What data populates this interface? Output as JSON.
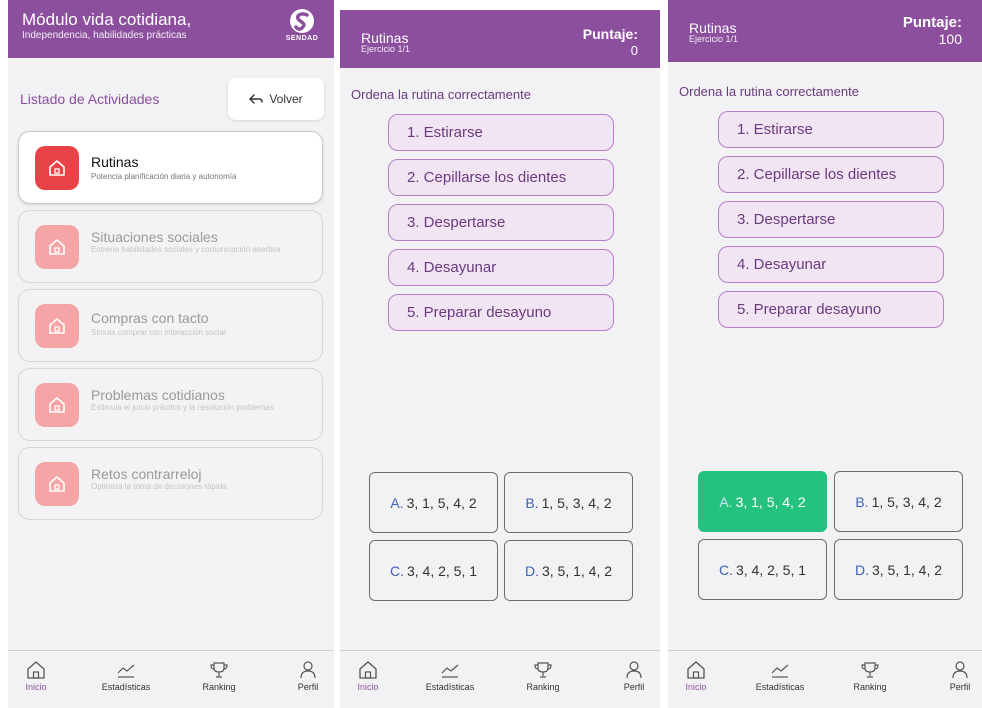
{
  "colors": {
    "header": "#8c4f9e",
    "accent_active_icon": "#e94349",
    "inactive_icon": "#f5a5a5",
    "correct_option": "#25c27f",
    "step_fill": "#f1e5f4"
  },
  "menu_screen": {
    "header": {
      "title": "Módulo vida cotidiana,",
      "subtitle": "Independencia, habilidades prácticas",
      "logo_text": "SENDAD"
    },
    "list_title": "Listado de Actividades",
    "back_label": "Volver",
    "activities": [
      {
        "name": "Rutinas",
        "description": "Potencia planificación diaria y autonomía",
        "icon": "home-icon",
        "active": true
      },
      {
        "name": "Situaciones sociales",
        "description": "Entrena habilidades sociales y comunicación asertiva",
        "icon": "home-icon",
        "active": false
      },
      {
        "name": "Compras con tacto",
        "description": "Simula comprar con interacción social",
        "icon": "home-icon",
        "active": false
      },
      {
        "name": "Problemas cotidianos",
        "description": "Estimula el juicio práctico y la resolución problemas",
        "icon": "home-icon",
        "active": false
      },
      {
        "name": "Retos contrarreloj",
        "description": "Optimiza la toma de decisiones rápida",
        "icon": "home-icon",
        "active": false
      }
    ]
  },
  "exercise_before": {
    "title": "Rutinas",
    "subtitle": "Ejercicio 1/1",
    "score_label": "Puntaje:",
    "score": "0",
    "instruction": "Ordena la rutina correctamente",
    "steps": [
      "1. Estirarse",
      "2. Cepillarse los dientes",
      "3. Despertarse",
      "4. Desayunar",
      "5. Preparar desayuno"
    ],
    "options": [
      {
        "letter": "A.",
        "value": "3, 1, 5, 4, 2"
      },
      {
        "letter": "B.",
        "value": "1, 5, 3, 4, 2"
      },
      {
        "letter": "C.",
        "value": "3, 4, 2, 5, 1"
      },
      {
        "letter": "D.",
        "value": "3, 5, 1, 4, 2"
      }
    ]
  },
  "exercise_after": {
    "title": "Rutinas",
    "subtitle": "Ejercicio 1/1",
    "score_label": "Puntaje:",
    "score": "100",
    "instruction": "Ordena la rutina correctamente",
    "steps": [
      "1. Estirarse",
      "2. Cepillarse los dientes",
      "3. Despertarse",
      "4. Desayunar",
      "5. Preparar desayuno"
    ],
    "options": [
      {
        "letter": "A.",
        "value": "3, 1, 5, 4, 2",
        "state": "correct"
      },
      {
        "letter": "B.",
        "value": "1, 5, 3, 4, 2"
      },
      {
        "letter": "C.",
        "value": "3, 4, 2, 5, 1"
      },
      {
        "letter": "D.",
        "value": "3, 5, 1, 4, 2"
      }
    ]
  },
  "nav": {
    "items": [
      {
        "label": "Inicio",
        "icon": "home-icon",
        "active": true
      },
      {
        "label": "Estadísticas",
        "icon": "chart-icon",
        "active": false
      },
      {
        "label": "Ranking",
        "icon": "trophy-icon",
        "active": false
      },
      {
        "label": "Perfil",
        "icon": "user-icon",
        "active": false
      }
    ]
  }
}
